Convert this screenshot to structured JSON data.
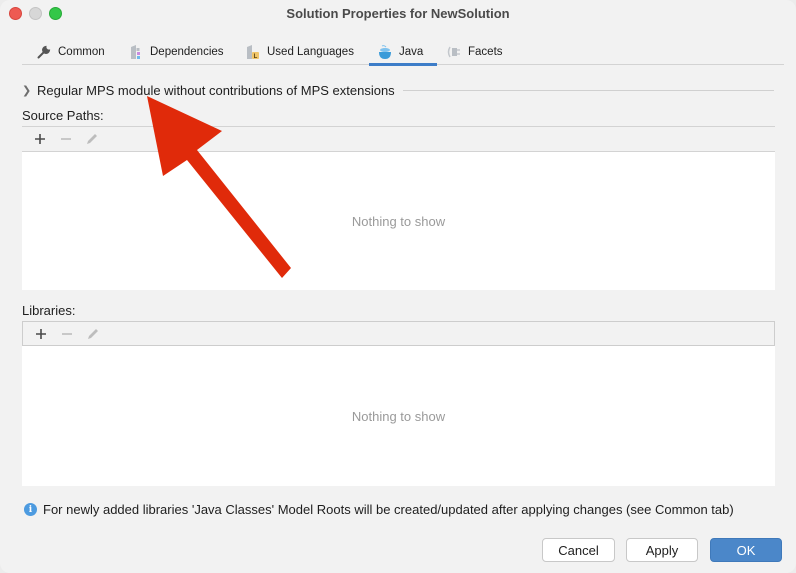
{
  "window": {
    "title": "Solution Properties for NewSolution"
  },
  "tabs": [
    {
      "label": "Common",
      "icon": "wrench-icon",
      "active": false
    },
    {
      "label": "Dependencies",
      "icon": "dependencies-icon",
      "active": false
    },
    {
      "label": "Used Languages",
      "icon": "used-languages-icon",
      "active": false
    },
    {
      "label": "Java",
      "icon": "java-cup-icon",
      "active": true
    },
    {
      "label": "Facets",
      "icon": "facets-plug-icon",
      "active": false
    }
  ],
  "java": {
    "module_kind": "Regular MPS module without contributions of MPS extensions",
    "source_paths": {
      "label": "Source Paths:",
      "empty_text": "Nothing to show",
      "toolbar": [
        "add-icon",
        "remove-icon",
        "edit-icon"
      ]
    },
    "libraries": {
      "label": "Libraries:",
      "empty_text": "Nothing to show",
      "toolbar": [
        "add-icon",
        "remove-icon",
        "edit-icon"
      ]
    },
    "info_text": "For newly added libraries 'Java Classes' Model Roots will be created/updated after applying changes (see Common tab)"
  },
  "buttons": {
    "cancel": "Cancel",
    "apply": "Apply",
    "ok": "OK"
  },
  "annotation": {
    "type": "arrow",
    "color": "#e02a0a",
    "points_to": "module-kind-expander"
  }
}
